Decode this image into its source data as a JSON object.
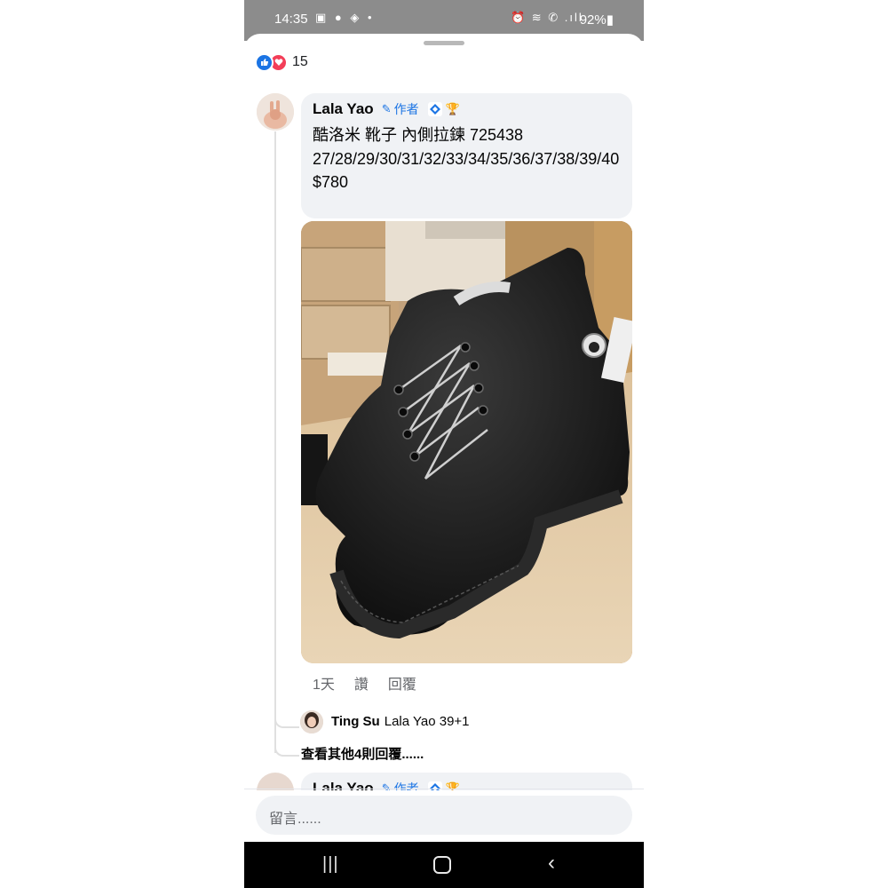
{
  "status_bar": {
    "time": "14:35",
    "left_icons": "▣ ● ◈ •",
    "right_icons": "⏰ ≋ ✆ .ıll",
    "battery": "92%▮"
  },
  "reactions": {
    "count": "15",
    "types": [
      "like",
      "love"
    ]
  },
  "comment": {
    "author": "Lala Yao",
    "author_badge": "作者",
    "text": "酷洛米 靴子 內側拉鍊 725438\n27/28/29/30/31/32/33/34/35/36/37/38/39/40\n$780",
    "time": "1天",
    "like_label": "讚",
    "reply_label": "回覆"
  },
  "reply_preview": {
    "author": "Ting Su",
    "text": "Lala Yao 39+1"
  },
  "more_replies_label": "查看其他4則回覆......",
  "next_comment": {
    "author": "Lala Yao",
    "author_badge": "作者"
  },
  "comment_input": {
    "placeholder": "留言......"
  },
  "colors": {
    "accent": "#1b74e4",
    "love": "#f33e58",
    "bubble": "#f0f2f5",
    "status_bar": "#8c8c8c"
  }
}
